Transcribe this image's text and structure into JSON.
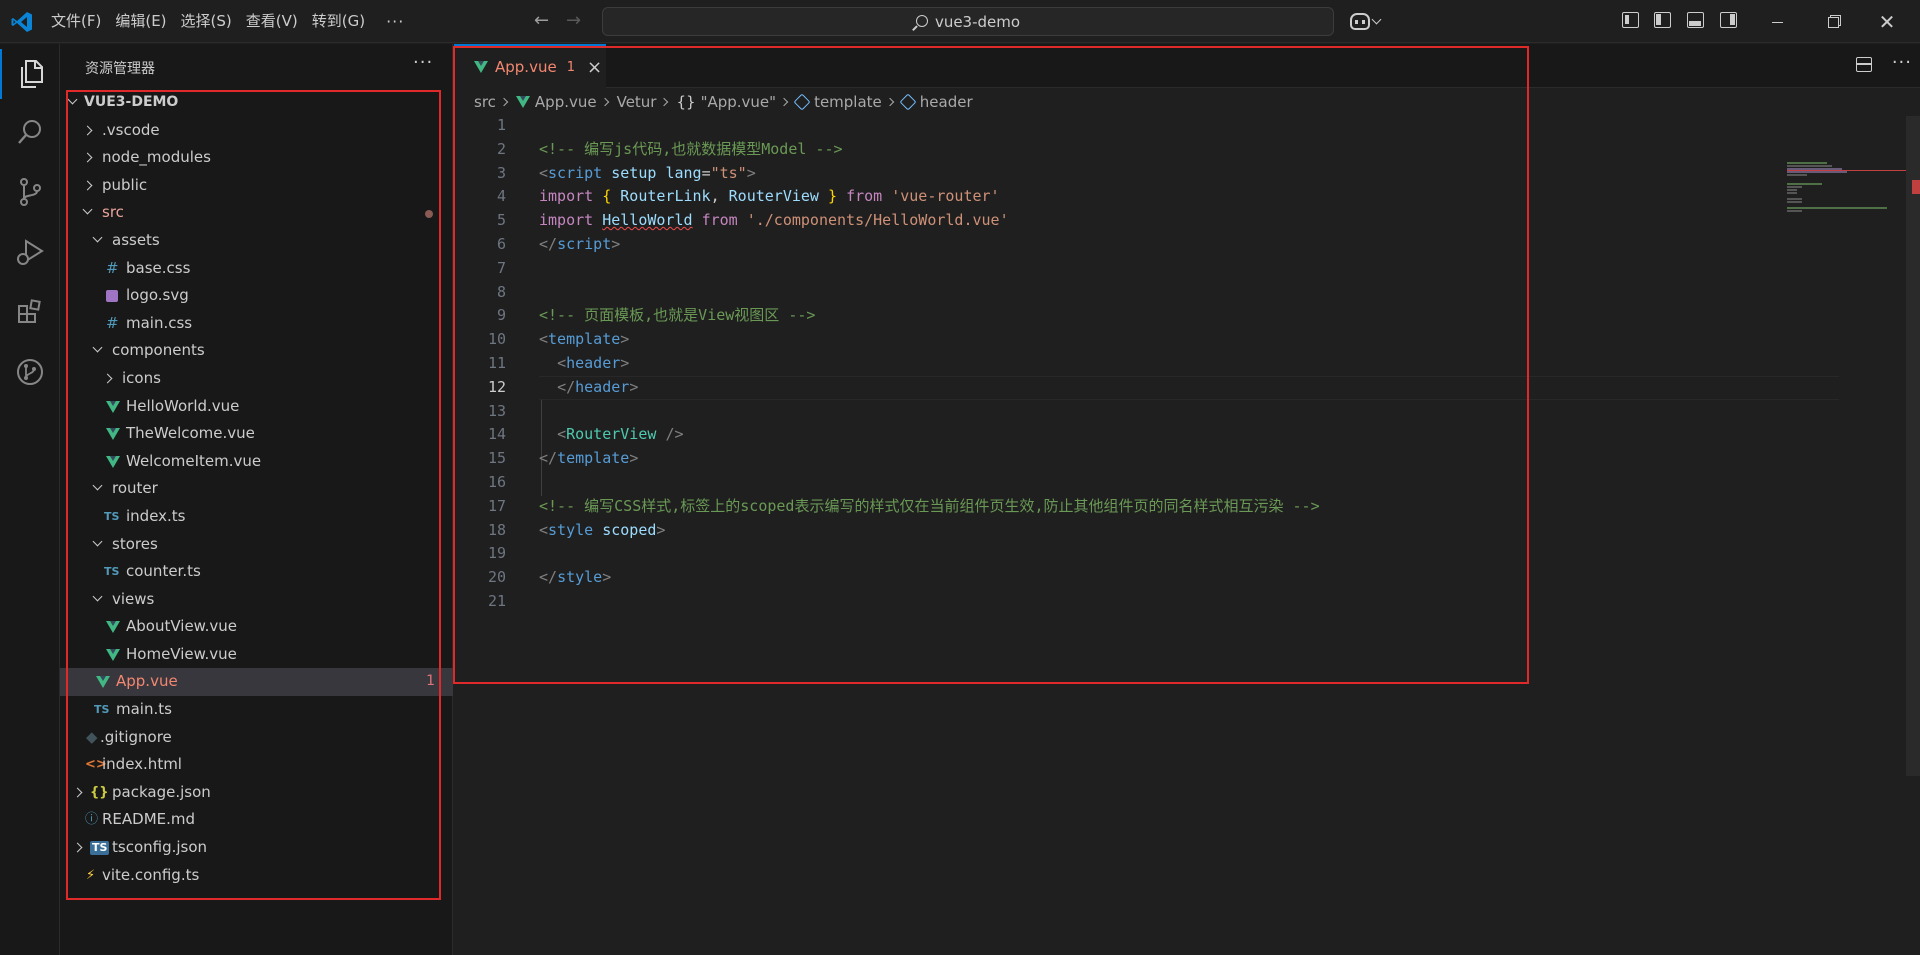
{
  "titlebar": {
    "menu": [
      "文件(F)",
      "编辑(E)",
      "选择(S)",
      "查看(V)",
      "转到(G)"
    ],
    "more": "···",
    "search_text": "vue3-demo"
  },
  "sidebar": {
    "title": "资源管理器",
    "more": "···",
    "root": "VUE3-DEMO",
    "items": [
      {
        "label": ".vscode",
        "depth": 1,
        "kind": "folder",
        "open": false
      },
      {
        "label": "node_modules",
        "depth": 1,
        "kind": "folder",
        "open": false
      },
      {
        "label": "public",
        "depth": 1,
        "kind": "folder",
        "open": false
      },
      {
        "label": "src",
        "depth": 1,
        "kind": "folder",
        "open": true,
        "status": "modified"
      },
      {
        "label": "assets",
        "depth": 2,
        "kind": "folder",
        "open": true
      },
      {
        "label": "base.css",
        "depth": 3,
        "kind": "css"
      },
      {
        "label": "logo.svg",
        "depth": 3,
        "kind": "svg"
      },
      {
        "label": "main.css",
        "depth": 3,
        "kind": "css"
      },
      {
        "label": "components",
        "depth": 2,
        "kind": "folder",
        "open": true
      },
      {
        "label": "icons",
        "depth": 3,
        "kind": "folder",
        "open": false
      },
      {
        "label": "HelloWorld.vue",
        "depth": 3,
        "kind": "vue"
      },
      {
        "label": "TheWelcome.vue",
        "depth": 3,
        "kind": "vue"
      },
      {
        "label": "WelcomeItem.vue",
        "depth": 3,
        "kind": "vue"
      },
      {
        "label": "router",
        "depth": 2,
        "kind": "folder",
        "open": true
      },
      {
        "label": "index.ts",
        "depth": 3,
        "kind": "ts"
      },
      {
        "label": "stores",
        "depth": 2,
        "kind": "folder",
        "open": true
      },
      {
        "label": "counter.ts",
        "depth": 3,
        "kind": "ts"
      },
      {
        "label": "views",
        "depth": 2,
        "kind": "folder",
        "open": true
      },
      {
        "label": "AboutView.vue",
        "depth": 3,
        "kind": "vue"
      },
      {
        "label": "HomeView.vue",
        "depth": 3,
        "kind": "vue"
      },
      {
        "label": "App.vue",
        "depth": 2,
        "kind": "vue",
        "selected": true,
        "badge": "1"
      },
      {
        "label": "main.ts",
        "depth": 2,
        "kind": "ts"
      },
      {
        "label": ".gitignore",
        "depth": 1,
        "kind": "git"
      },
      {
        "label": "index.html",
        "depth": 1,
        "kind": "html"
      },
      {
        "label": "package.json",
        "depth": 1,
        "kind": "json-folder"
      },
      {
        "label": "README.md",
        "depth": 1,
        "kind": "info"
      },
      {
        "label": "tsconfig.json",
        "depth": 1,
        "kind": "ts-folder"
      },
      {
        "label": "vite.config.ts",
        "depth": 1,
        "kind": "vite"
      }
    ]
  },
  "editor": {
    "tab": {
      "name": "App.vue",
      "badge": "1",
      "close": "×"
    },
    "breadcrumb": {
      "src": "src",
      "file": "App.vue",
      "vetur": "Vetur",
      "braces": "{}",
      "scope": "\"App.vue\"",
      "template": "template",
      "header": "header"
    },
    "line_numbers": [
      "1",
      "2",
      "3",
      "4",
      "5",
      "6",
      "7",
      "8",
      "9",
      "10",
      "11",
      "12",
      "13",
      "14",
      "15",
      "16",
      "17",
      "18",
      "19",
      "20",
      "21"
    ],
    "active_line": 12
  },
  "colors": {
    "accent": "#0078d4",
    "highlight_box": "#e02a2a",
    "error": "#f48771",
    "vue": "#41b883"
  }
}
